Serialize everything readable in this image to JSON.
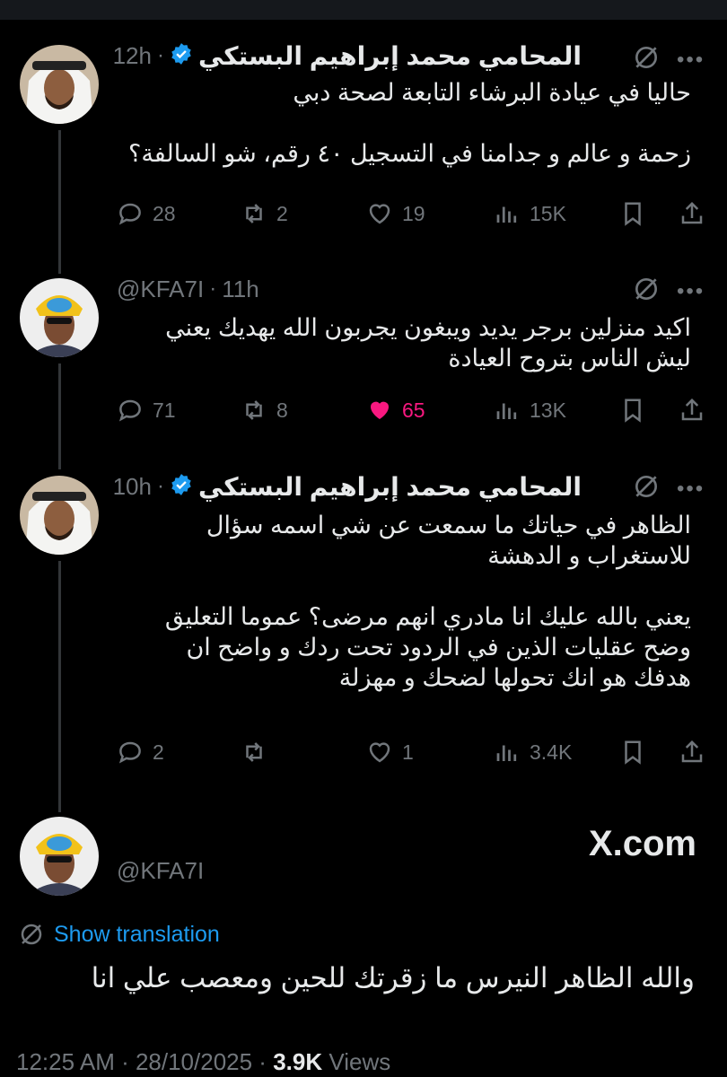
{
  "colors": {
    "background": "#000000",
    "text": "#e7e9ea",
    "muted": "#71767b",
    "link": "#1d9bf0",
    "like": "#f91880",
    "verified": "#1d9bf0"
  },
  "tweets": [
    {
      "author_name": "المحامي محمد إبراهيم البستكي",
      "verified": true,
      "time": "12h",
      "text": "حاليا في عيادة البرشاء التابعة لصحة دبي\n\nزحمة و عالم و جدامنا في التسجيل ٤٠ رقم، شو السالفة؟",
      "replies": "28",
      "reposts": "2",
      "likes": "19",
      "views": "15K",
      "liked": false
    },
    {
      "author_handle": "@KFA7I",
      "verified": false,
      "time": "11h",
      "text": "اكيد منزلين برجر يديد ويبغون يجربون الله يهديك يعني\nليش الناس بتروح العيادة",
      "replies": "71",
      "reposts": "8",
      "likes": "65",
      "views": "13K",
      "liked": true
    },
    {
      "author_name": "المحامي محمد إبراهيم البستكي",
      "verified": true,
      "time": "10h",
      "text": "الظاهر في حياتك ما سمعت عن شي اسمه سؤال\nللاستغراب و الدهشة\n\nيعني بالله عليك انا مادري انهم مرضى؟ عموما التعليق\nوضح عقليات الذين في الردود تحت ردك و واضح ان\nهدفك هو انك تحولها لضحك و مهزلة",
      "replies": "2",
      "reposts": "",
      "likes": "1",
      "views": "3.4K",
      "liked": false
    }
  ],
  "main_tweet": {
    "author_handle": "@KFA7I",
    "brand": "X.com",
    "show_translation": "Show translation",
    "text": "والله الظاهر النيرس ما زقرتك للحين ومعصب علي انا",
    "timestamp": "12:25 AM · 28/10/2025 · ",
    "views_count": "3.9K",
    "views_label": " Views"
  },
  "icons": [
    "reply-icon",
    "repost-icon",
    "like-icon",
    "views-icon",
    "bookmark-icon",
    "share-icon",
    "grok-icon",
    "more-icon",
    "verified-badge-icon",
    "translate-icon"
  ]
}
